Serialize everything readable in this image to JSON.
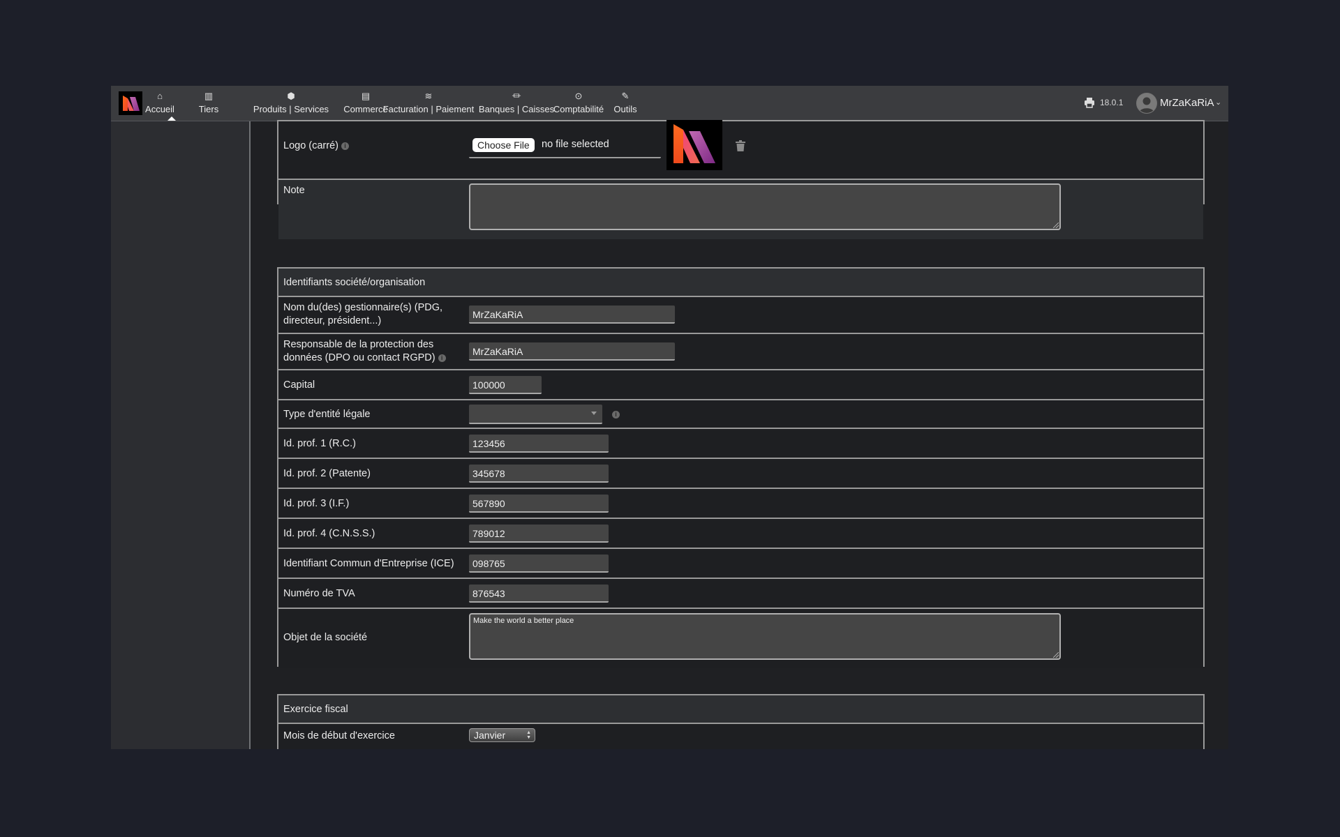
{
  "topbar": {
    "nav": [
      {
        "label": "Accueil",
        "icon": "home-icon",
        "glyph": "⌂"
      },
      {
        "label": "Tiers",
        "icon": "building-icon",
        "glyph": "▥"
      },
      {
        "label": "Produits | Services",
        "icon": "cube-icon",
        "glyph": "⬢"
      },
      {
        "label": "Commerce",
        "icon": "suitcase-icon",
        "glyph": "▤"
      },
      {
        "label": "Facturation | Paiement",
        "icon": "coins-icon",
        "glyph": "≋"
      },
      {
        "label": "Banques | Caisses",
        "icon": "bank-icon",
        "glyph": "⏛"
      },
      {
        "label": "Comptabilité",
        "icon": "search-dollar-icon",
        "glyph": "⊙"
      },
      {
        "label": "Outils",
        "icon": "wrench-icon",
        "glyph": "✎"
      }
    ],
    "active_index": 0,
    "version": "18.0.1",
    "username": "MrZaKaRiA",
    "user_caret": "⌄"
  },
  "company_block": {
    "logo_label": "Logo (carré)",
    "file_button": "Choose File",
    "file_status": "no file selected",
    "note_label": "Note",
    "note_value": ""
  },
  "identifiers": {
    "title": "Identifiants société/organisation",
    "manager_label_1": "Nom du(des) gestionnaire(s) (PDG,",
    "manager_label_2": "directeur, président...)",
    "manager_value": "MrZaKaRiA",
    "dpo_label_1": "Responsable de la protection des",
    "dpo_label_2": "données (DPO ou contact RGPD)",
    "dpo_value": "MrZaKaRiA",
    "capital_label": "Capital",
    "capital_value": "100000",
    "legal_type_label": "Type d'entité légale",
    "legal_type_value": "",
    "prof1_label": "Id. prof. 1 (R.C.)",
    "prof1_value": "123456",
    "prof2_label": "Id. prof. 2 (Patente)",
    "prof2_value": "345678",
    "prof3_label": "Id. prof. 3 (I.F.)",
    "prof3_value": "567890",
    "prof4_label": "Id. prof. 4 (C.N.S.S.)",
    "prof4_value": "789012",
    "ice_label": "Identifiant Commun d'Entreprise (ICE)",
    "ice_value": "098765",
    "vat_label": "Numéro de TVA",
    "vat_value": "876543",
    "object_label": "Objet de la société",
    "object_value": "Make the world a better place"
  },
  "fiscal": {
    "title": "Exercice fiscal",
    "start_month_label": "Mois de début d'exercice",
    "start_month_value": "Janvier"
  },
  "info_glyph": "i"
}
